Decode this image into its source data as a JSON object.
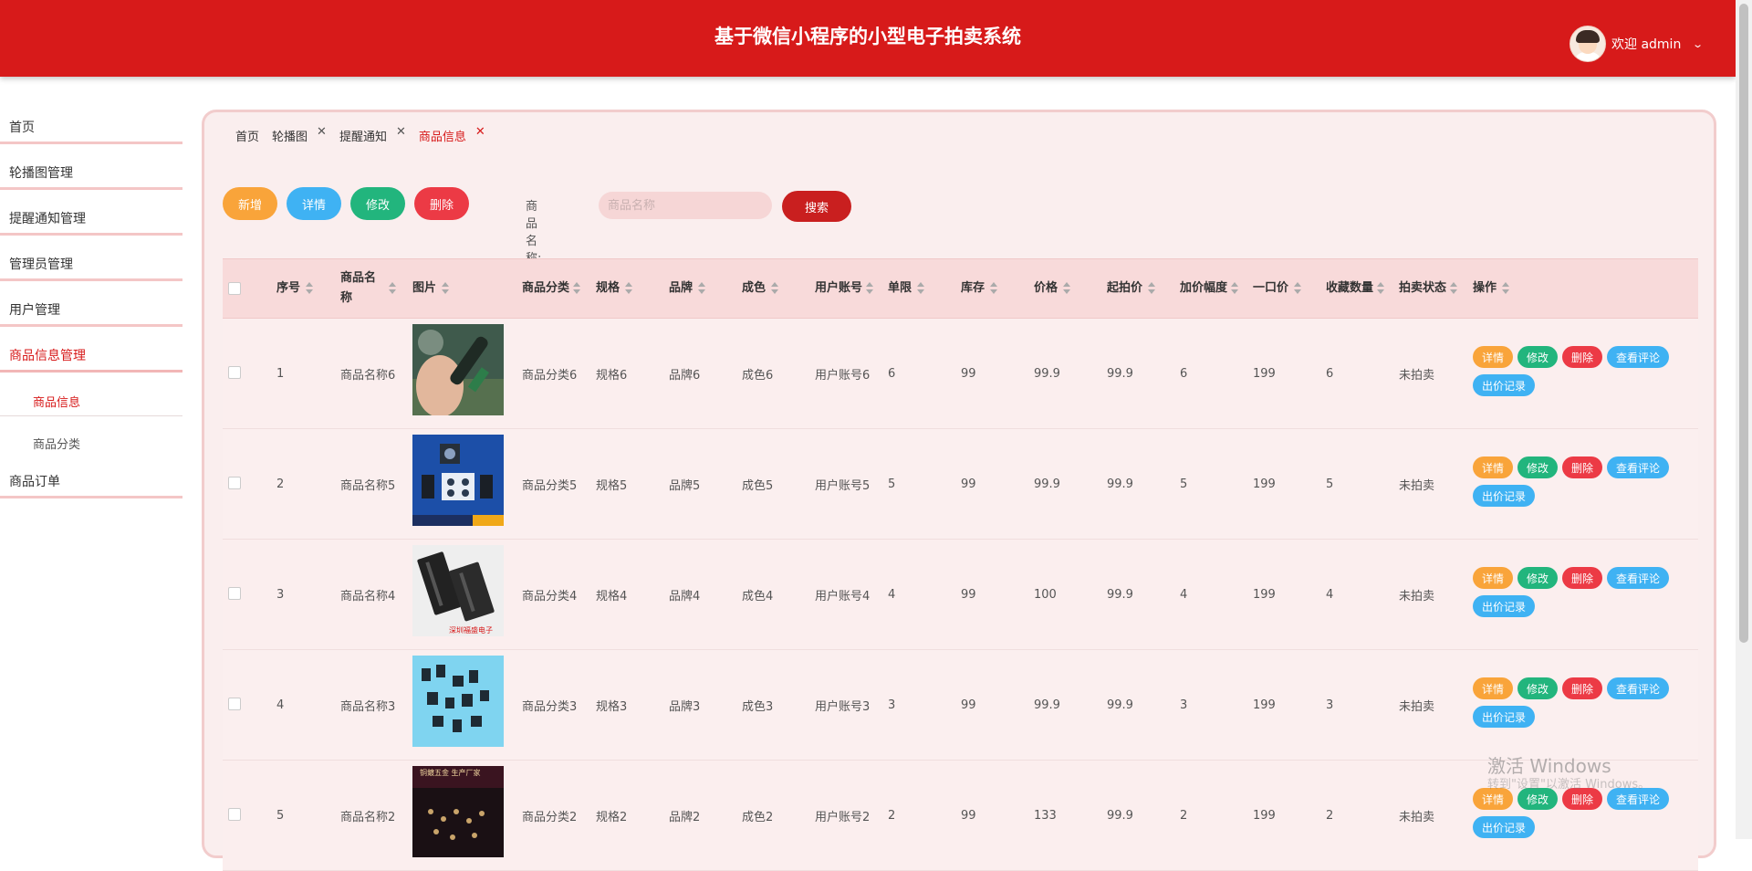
{
  "header": {
    "title": "基于微信小程序的小型电子拍卖系统",
    "welcome": "欢迎 admin"
  },
  "sidebar": {
    "items": [
      {
        "label": "首页"
      },
      {
        "label": "轮播图管理"
      },
      {
        "label": "提醒通知管理"
      },
      {
        "label": "管理员管理"
      },
      {
        "label": "用户管理"
      },
      {
        "label": "商品信息管理"
      }
    ],
    "sub_items": [
      {
        "label": "商品信息"
      },
      {
        "label": "商品分类"
      }
    ],
    "last_item": {
      "label": "商品订单"
    }
  },
  "tabs": [
    {
      "label": "首页"
    },
    {
      "label": "轮播图"
    },
    {
      "label": "提醒通知"
    },
    {
      "label": "商品信息"
    }
  ],
  "toolbar": {
    "add": "新增",
    "detail": "详情",
    "edit": "修改",
    "delete": "删除",
    "search_label": "商品名称:",
    "search_placeholder": "商品名称",
    "search_btn": "搜索"
  },
  "table": {
    "headers": {
      "index": "序号",
      "name": "商品名称",
      "image": "图片",
      "category": "商品分类",
      "spec": "规格",
      "brand": "品牌",
      "condition": "成色",
      "account": "用户账号",
      "limit": "单限",
      "stock": "库存",
      "price": "价格",
      "start_price": "起拍价",
      "increment": "加价幅度",
      "buyout": "一口价",
      "favorites": "收藏数量",
      "status": "拍卖状态",
      "actions": "操作"
    },
    "rows": [
      {
        "index": "1",
        "name": "商品名称6",
        "category": "商品分类6",
        "spec": "规格6",
        "brand": "品牌6",
        "condition": "成色6",
        "account": "用户账号6",
        "limit": "6",
        "stock": "99",
        "price": "99.9",
        "start_price": "99.9",
        "increment": "6",
        "buyout": "199",
        "favorites": "6",
        "status": "未拍卖",
        "image": "soldering-iron-photo"
      },
      {
        "index": "2",
        "name": "商品名称5",
        "category": "商品分类5",
        "spec": "规格5",
        "brand": "品牌5",
        "condition": "成色5",
        "account": "用户账号5",
        "limit": "5",
        "stock": "99",
        "price": "99.9",
        "start_price": "99.9",
        "increment": "5",
        "buyout": "199",
        "favorites": "5",
        "status": "未拍卖",
        "image": "switch-parts-photo"
      },
      {
        "index": "3",
        "name": "商品名称4",
        "category": "商品分类4",
        "spec": "规格4",
        "brand": "品牌4",
        "condition": "成色4",
        "account": "用户账号4",
        "limit": "4",
        "stock": "99",
        "price": "100",
        "start_price": "99.9",
        "increment": "4",
        "buyout": "199",
        "favorites": "4",
        "status": "未拍卖",
        "image": "connector-photo",
        "image_caption": "深圳福盛电子"
      },
      {
        "index": "4",
        "name": "商品名称3",
        "category": "商品分类3",
        "spec": "规格3",
        "brand": "品牌3",
        "condition": "成色3",
        "account": "用户账号3",
        "limit": "3",
        "stock": "99",
        "price": "99.9",
        "start_price": "99.9",
        "increment": "3",
        "buyout": "199",
        "favorites": "3",
        "status": "未拍卖",
        "image": "small-parts-photo"
      },
      {
        "index": "5",
        "name": "商品名称2",
        "category": "商品分类2",
        "spec": "规格2",
        "brand": "品牌2",
        "condition": "成色2",
        "account": "用户账号2",
        "limit": "2",
        "stock": "99",
        "price": "133",
        "start_price": "99.9",
        "increment": "2",
        "buyout": "199",
        "favorites": "2",
        "status": "未拍卖",
        "image": "hardware-photo",
        "image_caption": "铜鍍五金 生产厂家"
      }
    ],
    "row_actions": {
      "detail": "详情",
      "edit": "修改",
      "delete": "删除",
      "comments": "查看评论",
      "bids": "出价记录"
    }
  },
  "watermark": {
    "line1": "激活 Windows",
    "line2": "转到\"设置\"以激活 Windows。"
  },
  "colors": {
    "header": "#d71a1a",
    "orange": "#f9a43a",
    "blue": "#3fb2f3",
    "green": "#22b57d",
    "red": "#ec3a45"
  }
}
